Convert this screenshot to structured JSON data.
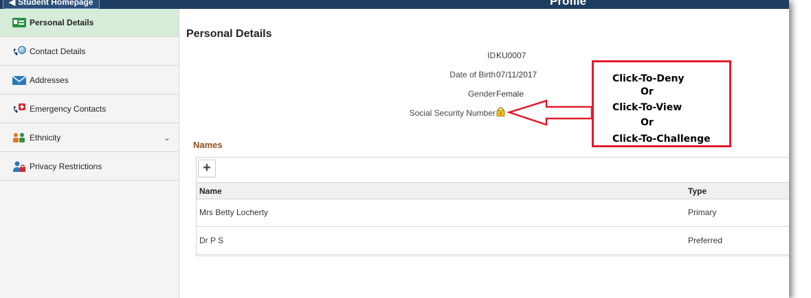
{
  "header": {
    "home_button": "Student Homepage",
    "title": "Profile"
  },
  "sidebar": {
    "items": [
      {
        "label": "Personal Details",
        "icon": "id-card-icon"
      },
      {
        "label": "Contact Details",
        "icon": "phone-email-icon"
      },
      {
        "label": "Addresses",
        "icon": "envelope-icon"
      },
      {
        "label": "Emergency Contacts",
        "icon": "phone-emergency-icon"
      },
      {
        "label": "Ethnicity",
        "icon": "people-icon"
      },
      {
        "label": "Privacy Restrictions",
        "icon": "person-lock-icon"
      }
    ]
  },
  "main": {
    "title": "Personal Details",
    "fields": [
      {
        "label": "ID",
        "value": "KU0007"
      },
      {
        "label": "Date of Birth",
        "value": "07/11/2017"
      },
      {
        "label": "Gender",
        "value": "Female"
      },
      {
        "label": "Social Security Number",
        "value": ""
      }
    ],
    "names": {
      "heading": "Names",
      "columns": [
        "Name",
        "Type"
      ],
      "rows": [
        {
          "name": "Mrs Betty Locherty",
          "type": "Primary"
        },
        {
          "name": "Dr P S",
          "type": "Preferred"
        }
      ]
    }
  },
  "annotation": {
    "lines": [
      "Click-To-Deny",
      "Or",
      "Click-To-View",
      "Or",
      "Click-To-Challenge"
    ],
    "color": "#e01b2b"
  },
  "colors": {
    "banner": "#1e3e61",
    "active_nav": "#d6ecd9",
    "section_heading": "#8d4f1b"
  }
}
